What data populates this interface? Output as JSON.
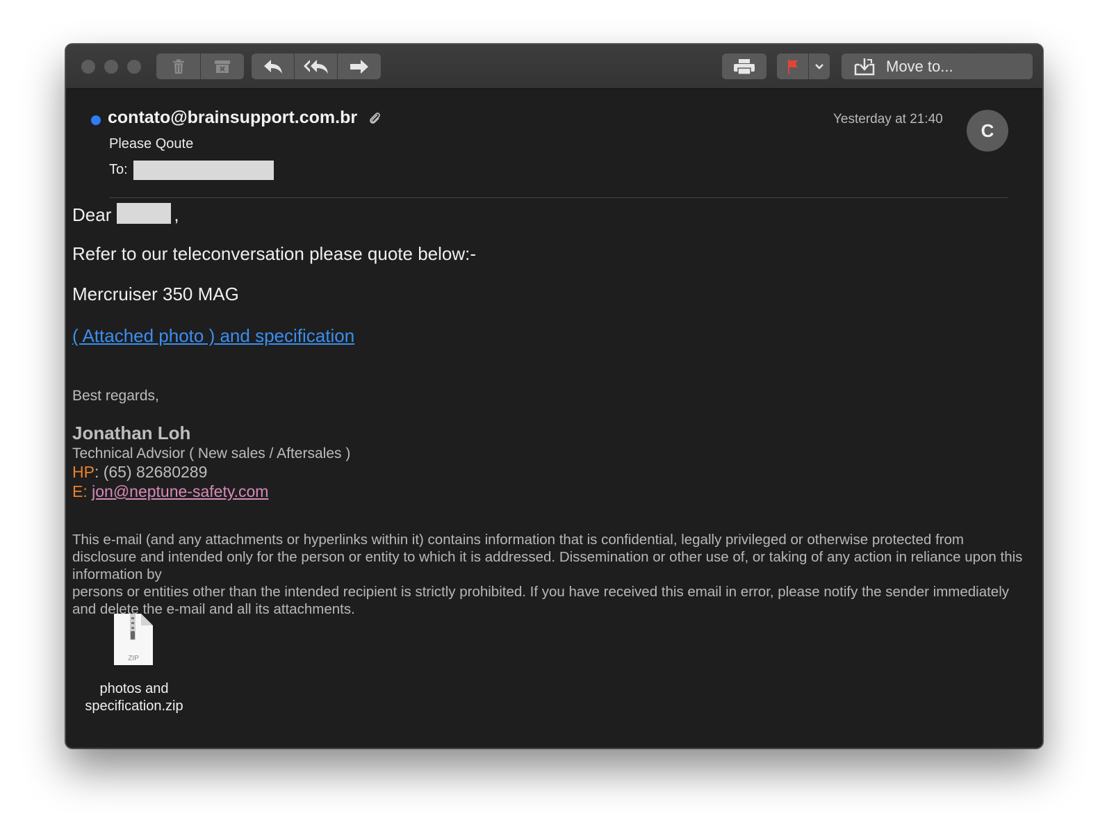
{
  "toolbar": {
    "move_label": "Move to...",
    "flag_color": "#e0453a"
  },
  "message": {
    "sender": "contato@brainsupport.com.br",
    "subject": "Please Qoute",
    "to_label": "To:",
    "date": "Yesterday at 21:40",
    "avatar_initial": "C",
    "accent": "#2e7cf6"
  },
  "body": {
    "greeting_prefix": "Dear",
    "greeting_suffix": ",",
    "line1": "Refer to our teleconversation please quote below:-",
    "line2": "Mercruiser 350 MAG",
    "link_text": "( Attached photo ) and specification",
    "regards": "Best regards,"
  },
  "signature": {
    "name": "Jonathan Loh",
    "title": "Technical Advsior ( New sales / Aftersales )",
    "hp_label": "HP",
    "hp_value": ": (65) 82680289",
    "email_label": "E",
    "email_sep": ": ",
    "email": "jon@neptune-safety.com"
  },
  "disclaimer": {
    "part1": "This e-mail (and any attachments or hyperlinks within it) contains information that is confidential, legally privileged or otherwise protected from disclosure and intended only for the person or entity to which it is addressed. Dissemination or other use of, or taking of any action in reliance upon this information by",
    "part2": "persons or entities other than the intended recipient is strictly prohibited. If you have received this email in error, please notify the sender immediately and delete the e-mail and all its attachments."
  },
  "attachment": {
    "badge": "ZIP",
    "filename_line1": "photos and",
    "filename_line2": "specification.zip"
  }
}
